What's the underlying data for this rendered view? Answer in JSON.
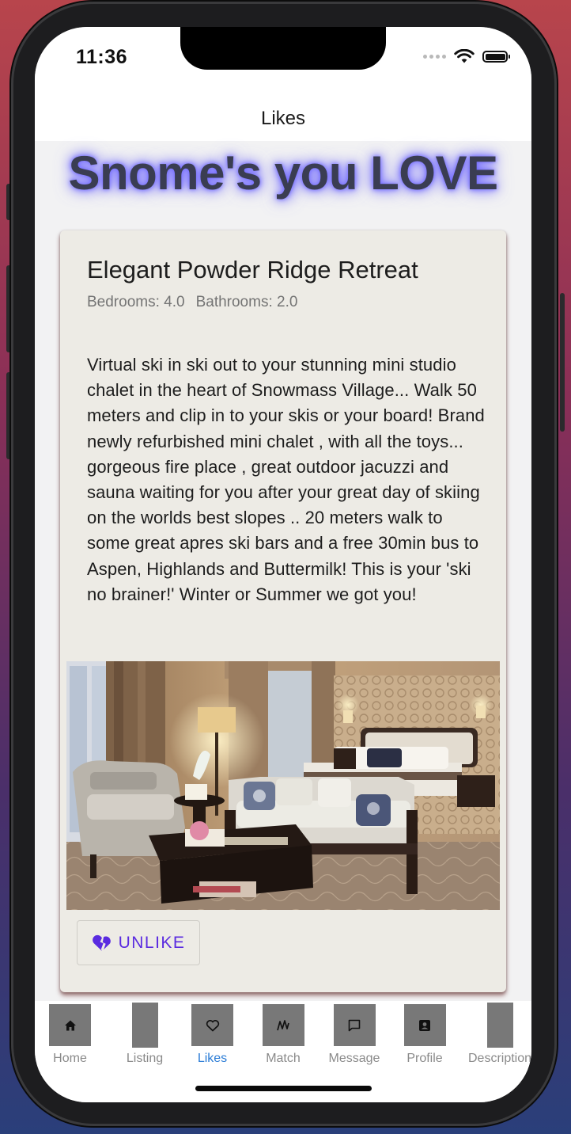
{
  "status_bar": {
    "time": "11:36"
  },
  "nav": {
    "title": "Likes"
  },
  "headline": "Snome's you LOVE",
  "listing": {
    "title": "Elegant Powder Ridge Retreat",
    "bedrooms": "Bedrooms: 4.0",
    "bathrooms": "Bathrooms: 2.0",
    "description": "Virtual ski in ski out to your stunning mini studio chalet in the heart of Snowmass Village... Walk 50 meters and clip in to your skis or your board! Brand newly refurbished mini chalet , with all the toys... gorgeous fire place , great outdoor jacuzzi and sauna waiting for you after your great day of skiing on the worlds best slopes .. 20 meters walk to some great apres ski bars and a free 30min bus to Aspen, Highlands and Buttermilk! This is your 'ski no brainer!' Winter or Summer we got you!",
    "unlike_label": "UNLIKE",
    "unlike_icon": "heart-broken-icon"
  },
  "tabs": [
    {
      "label": "Home",
      "icon": "home-icon",
      "active": false
    },
    {
      "label": "Listing",
      "icon": "",
      "active": false
    },
    {
      "label": "Likes",
      "icon": "heart-outline-icon",
      "active": true
    },
    {
      "label": "Match",
      "icon": "match-icon",
      "active": false
    },
    {
      "label": "Message",
      "icon": "message-icon",
      "active": false
    },
    {
      "label": "Profile",
      "icon": "profile-card-icon",
      "active": false
    },
    {
      "label": "Description",
      "icon": "",
      "active": false
    }
  ],
  "colors": {
    "accent": "#5a2be0",
    "active_tab": "#2b7cd6",
    "headline_glow": "#6b63ff",
    "card_bg": "#edebe5"
  }
}
